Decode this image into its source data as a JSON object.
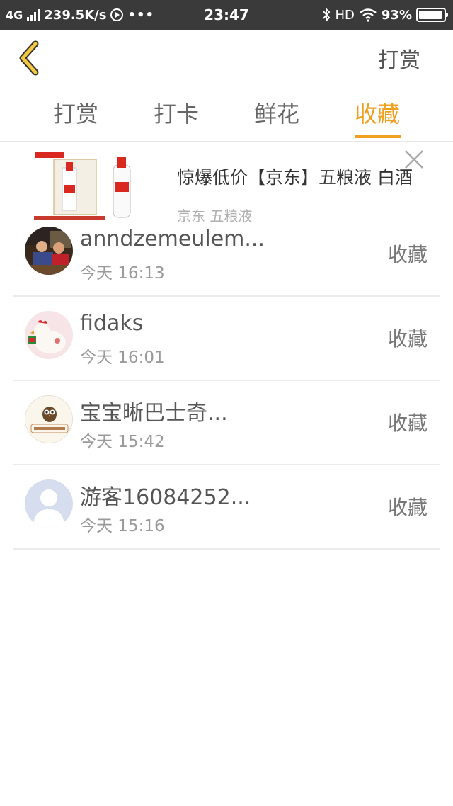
{
  "status_bar": {
    "network": "4G",
    "speed": "239.5K/s",
    "dots": "•••",
    "time": "23:47",
    "bluetooth_icon": "bluetooth-icon",
    "hd": "HD",
    "wifi_icon": "wifi-icon",
    "battery_percent": "93%",
    "battery_level": 0.93
  },
  "header": {
    "back_icon": "chevron-left-icon",
    "right_label": "打赏",
    "accent_color": "#f0a020"
  },
  "tabs": [
    {
      "label": "打赏",
      "active": false
    },
    {
      "label": "打卡",
      "active": false
    },
    {
      "label": "鲜花",
      "active": false
    },
    {
      "label": "收藏",
      "active": true
    }
  ],
  "ad": {
    "title": "惊爆低价【京东】五粮液 白酒",
    "subtitle": "京东 五粮液",
    "close_icon": "close-icon"
  },
  "list": [
    {
      "name": "anndzemeulem...",
      "time": "今天 16:13",
      "action": "收藏",
      "avatar": "photo-avatar"
    },
    {
      "name": "fidaks",
      "time": "今天 16:01",
      "action": "收藏",
      "avatar": "chicken-avatar"
    },
    {
      "name": "宝宝晰巴士奇...",
      "time": "今天 15:42",
      "action": "收藏",
      "avatar": "owl-avatar"
    },
    {
      "name": "游客16084252...",
      "time": "今天 15:16",
      "action": "收藏",
      "avatar": "default-user-avatar"
    }
  ]
}
